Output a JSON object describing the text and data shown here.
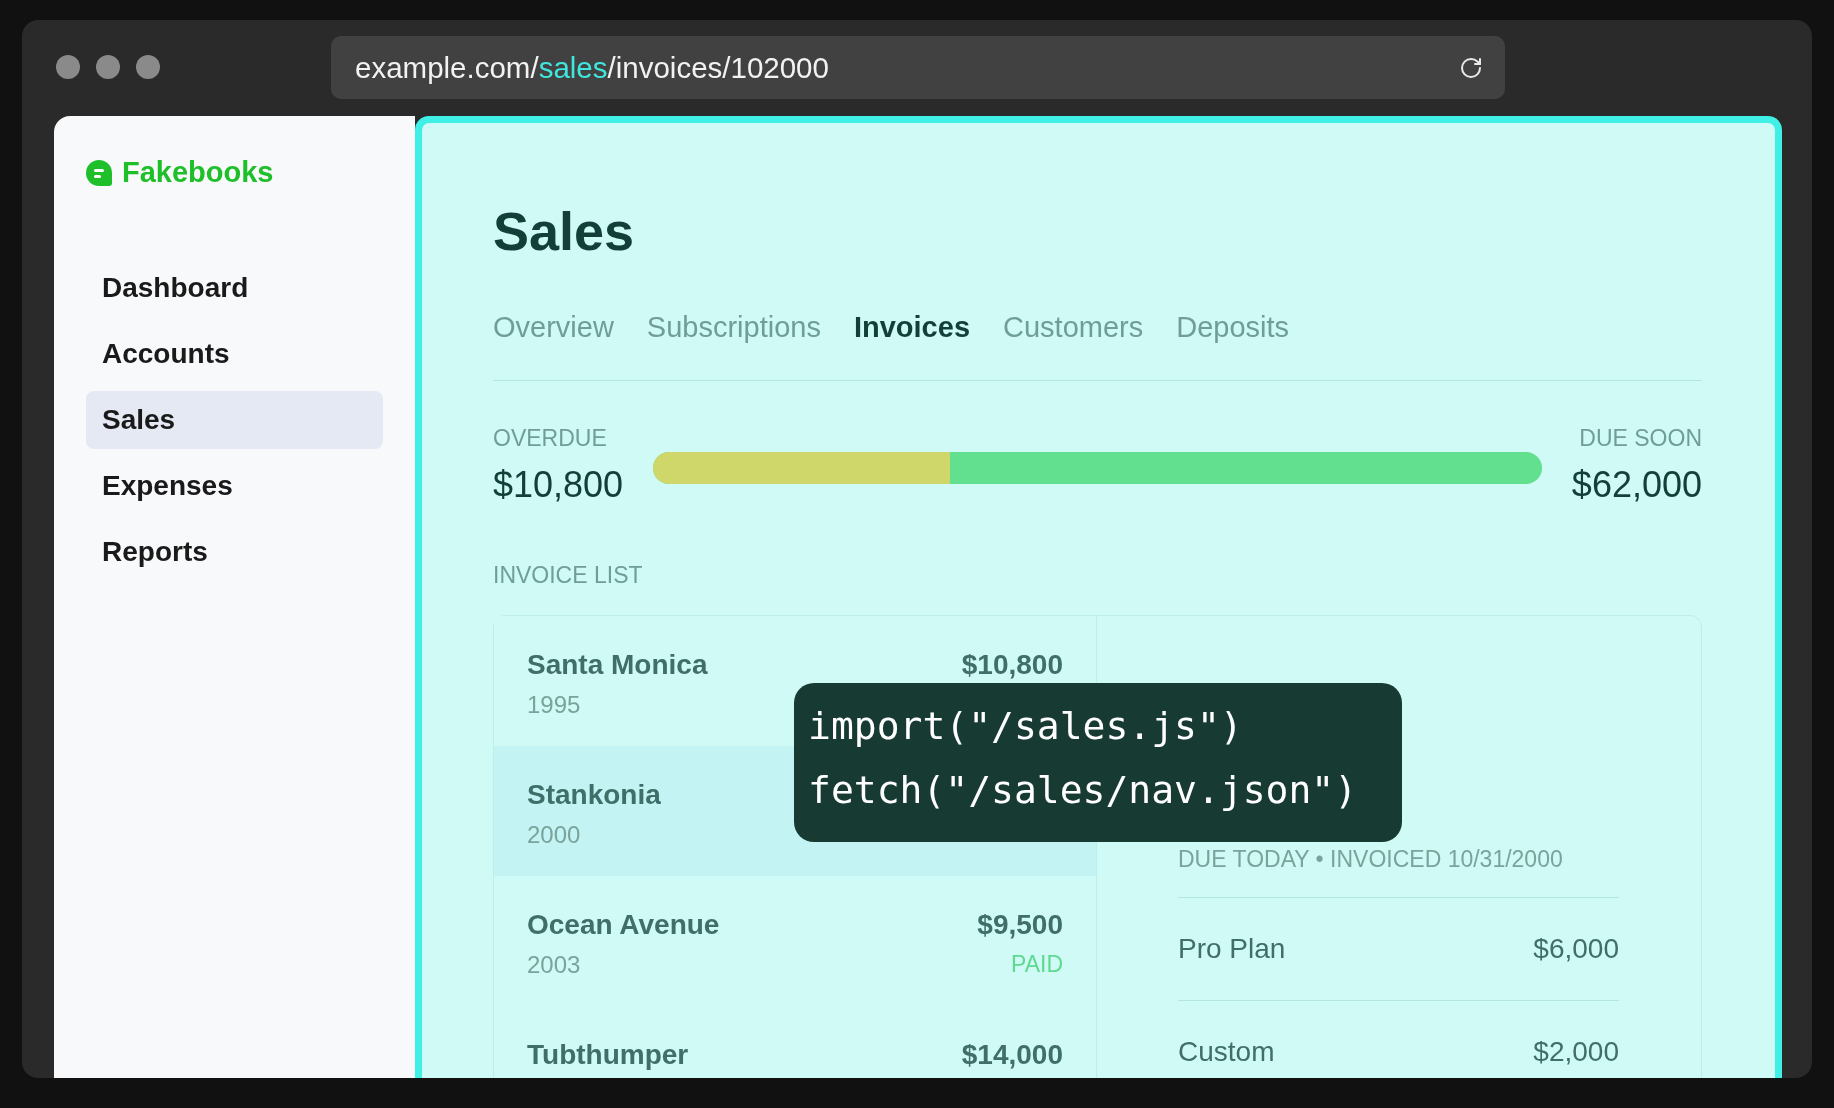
{
  "browser": {
    "url": [
      {
        "text": "example.com/",
        "highlight": false
      },
      {
        "text": "sales",
        "highlight": true
      },
      {
        "text": "/invoices/102000",
        "highlight": false
      }
    ]
  },
  "sidebar": {
    "brand": "Fakebooks",
    "items": [
      {
        "label": "Dashboard",
        "selected": false
      },
      {
        "label": "Accounts",
        "selected": false
      },
      {
        "label": "Sales",
        "selected": true
      },
      {
        "label": "Expenses",
        "selected": false
      },
      {
        "label": "Reports",
        "selected": false
      }
    ]
  },
  "main": {
    "title": "Sales",
    "tabs": [
      {
        "label": "Overview",
        "selected": false
      },
      {
        "label": "Subscriptions",
        "selected": false
      },
      {
        "label": "Invoices",
        "selected": true
      },
      {
        "label": "Customers",
        "selected": false
      },
      {
        "label": "Deposits",
        "selected": false
      }
    ],
    "summary": {
      "overdue_label": "OVERDUE",
      "overdue_amount": "$10,800",
      "due_soon_label": "DUE SOON",
      "due_soon_amount": "$62,000",
      "level": 0.334
    },
    "invoice_list_label": "INVOICE LIST",
    "invoices": [
      {
        "name": "Santa Monica",
        "year": "1995",
        "amount": "$10,800",
        "selected": false
      },
      {
        "name": "Stankonia",
        "year": "2000",
        "selected": true
      },
      {
        "name": "Ocean Avenue",
        "year": "2003",
        "amount": "$9,500",
        "status": "PAID",
        "color": "#5ed98f",
        "selected": false
      },
      {
        "name": "Tubthumper",
        "amount": "$14,000",
        "selected": false
      }
    ],
    "detail": {
      "meta": "DUE TODAY • INVOICED 10/31/2000",
      "line_items": [
        {
          "label": "Pro Plan",
          "amount": "$6,000"
        },
        {
          "label": "Custom",
          "amount": "$2,000"
        }
      ]
    }
  },
  "overlay": {
    "lines": [
      "import(\"/sales.js\")",
      "fetch(\"/sales/nav.json\")"
    ]
  }
}
